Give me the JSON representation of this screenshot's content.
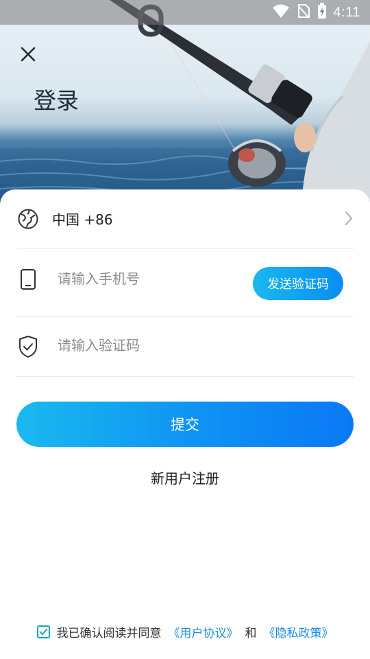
{
  "status_bar": {
    "time": "4:11",
    "icons": [
      "wifi-icon",
      "no-sim-icon",
      "battery-charging-icon"
    ]
  },
  "header": {
    "title": "登录",
    "close_icon": "close-icon"
  },
  "form": {
    "country": {
      "label": "中国 +86",
      "icon": "globe-icon"
    },
    "phone": {
      "placeholder": "请输入手机号",
      "value": "",
      "icon": "phone-icon"
    },
    "send_code_label": "发送验证码",
    "code": {
      "placeholder": "请输入验证码",
      "value": "",
      "icon": "shield-check-icon"
    },
    "submit_label": "提交",
    "register_label": "新用户注册"
  },
  "agreement": {
    "checked": true,
    "text": "我已确认阅读并同意",
    "user_agreement": "《用户协议》",
    "and": "和",
    "privacy_policy": "《隐私政策》"
  },
  "colors": {
    "accent_start": "#19b8f0",
    "accent_end": "#0a78f5",
    "link": "#1a8de0",
    "checkbox": "#17a7b5"
  }
}
